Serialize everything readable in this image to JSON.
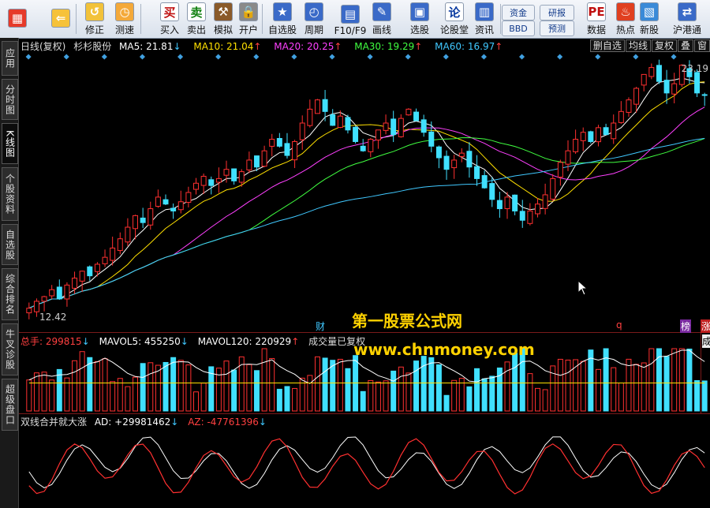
{
  "toolbar": {
    "buttons": [
      {
        "label": "",
        "icon": "home-icon"
      },
      {
        "label": "",
        "icon": "back-arrow-icon"
      },
      {
        "label": "修正",
        "icon": "fix-icon"
      },
      {
        "label": "测速",
        "icon": "clock-icon"
      },
      {
        "label": "买入",
        "icon": "buy-icon",
        "glyph": "买"
      },
      {
        "label": "卖出",
        "icon": "sell-icon",
        "glyph": "卖"
      },
      {
        "label": "模拟",
        "icon": "hammer-icon"
      },
      {
        "label": "开户",
        "icon": "lock-icon"
      },
      {
        "label": "自选股",
        "icon": "star-icon"
      },
      {
        "label": "周期",
        "icon": "period-icon"
      },
      {
        "label": "F10/F9",
        "icon": "f10-icon"
      },
      {
        "label": "画线",
        "icon": "pen-icon"
      },
      {
        "label": "选股",
        "icon": "stock-select-icon"
      },
      {
        "label": "论股堂",
        "icon": "forum-icon",
        "glyph": "论"
      },
      {
        "label": "资讯",
        "icon": "news-icon"
      },
      {
        "label": "数据",
        "icon": "pe-icon",
        "glyph": "PE"
      },
      {
        "label": "热点",
        "icon": "hot-icon"
      },
      {
        "label": "新股",
        "icon": "new-stock-icon"
      },
      {
        "label": "沪港通",
        "icon": "hk-connect-icon"
      }
    ],
    "small_buttons": [
      "资金",
      "BBD",
      "研报",
      "预测"
    ]
  },
  "leftbar": {
    "tabs": [
      "应用",
      "分时图",
      "K线图",
      "个股资料",
      "自选股",
      "综合排名",
      "牛叉诊股",
      "超级盘口"
    ]
  },
  "chart_info": {
    "period": "日线(复权)",
    "stock": "杉杉股份",
    "ma": [
      {
        "label": "MA5: 21.81",
        "arrow": "↓",
        "color": "#ffffff"
      },
      {
        "label": "MA10: 21.04",
        "arrow": "↑",
        "color": "#ffe000"
      },
      {
        "label": "MA20: 20.25",
        "arrow": "↑",
        "color": "#ff40ff"
      },
      {
        "label": "MA30: 19.29",
        "arrow": "↑",
        "color": "#40ff40"
      },
      {
        "label": "MA60: 16.97",
        "arrow": "↑",
        "color": "#40c8ff"
      }
    ],
    "right_buttons": [
      "删自选",
      "均线",
      "复权",
      "叠",
      "窗"
    ],
    "high_label": "23.19",
    "low_label": "12.42",
    "event_marks": [
      "财",
      "q",
      "榜",
      "涨"
    ]
  },
  "volume_info": {
    "total": "总手: 299815",
    "total_arrow": "↓",
    "mavol5": "MAVOL5: 455250",
    "mavol5_arrow": "↓",
    "mavol120": "MAVOL120: 220929",
    "mavol120_arrow": "↑",
    "note": "成交量已复权",
    "right_tag": "成"
  },
  "indicator_info": {
    "name": "双线合并就大涨",
    "ad": "AD: +29981462",
    "ad_arrow": "↓",
    "az": "AZ: -47761396",
    "az_arrow": "↓"
  },
  "watermark": {
    "line1": "第一股票公式网",
    "line2": "www.chnmoney.com"
  },
  "colors": {
    "up": "#ff3030",
    "down": "#40e0ff",
    "ma5": "#ffffff",
    "ma10": "#ffe000",
    "ma20": "#ff40ff",
    "ma30": "#40ff40",
    "ma60": "#40c8ff"
  },
  "chart_data": {
    "type": "candlestick",
    "price_range": [
      12.42,
      23.19
    ],
    "closes": [
      12.6,
      12.9,
      13.1,
      13.4,
      13.0,
      13.6,
      13.9,
      14.2,
      14.0,
      14.5,
      14.8,
      15.2,
      15.6,
      16.1,
      16.6,
      16.3,
      16.9,
      17.4,
      17.1,
      16.8,
      17.2,
      17.6,
      18.0,
      18.3,
      17.9,
      18.2,
      18.6,
      18.1,
      18.5,
      19.0,
      18.7,
      19.4,
      19.9,
      19.6,
      19.2,
      19.8,
      20.6,
      21.2,
      21.6,
      21.1,
      20.5,
      20.9,
      20.3,
      19.8,
      19.4,
      19.9,
      20.3,
      20.6,
      20.1,
      20.8,
      21.2,
      20.7,
      20.2,
      19.6,
      19.1,
      18.6,
      19.0,
      19.3,
      18.7,
      18.2,
      17.8,
      17.3,
      16.9,
      17.4,
      16.8,
      16.4,
      16.8,
      17.1,
      17.5,
      18.2,
      18.9,
      19.4,
      19.9,
      20.2,
      19.8,
      20.4,
      20.1,
      20.6,
      21.1,
      21.6,
      22.1,
      22.7,
      23.0,
      22.4,
      21.9,
      22.3,
      23.1,
      22.6,
      21.9,
      21.8
    ],
    "volume_range": [
      0,
      900000
    ]
  }
}
